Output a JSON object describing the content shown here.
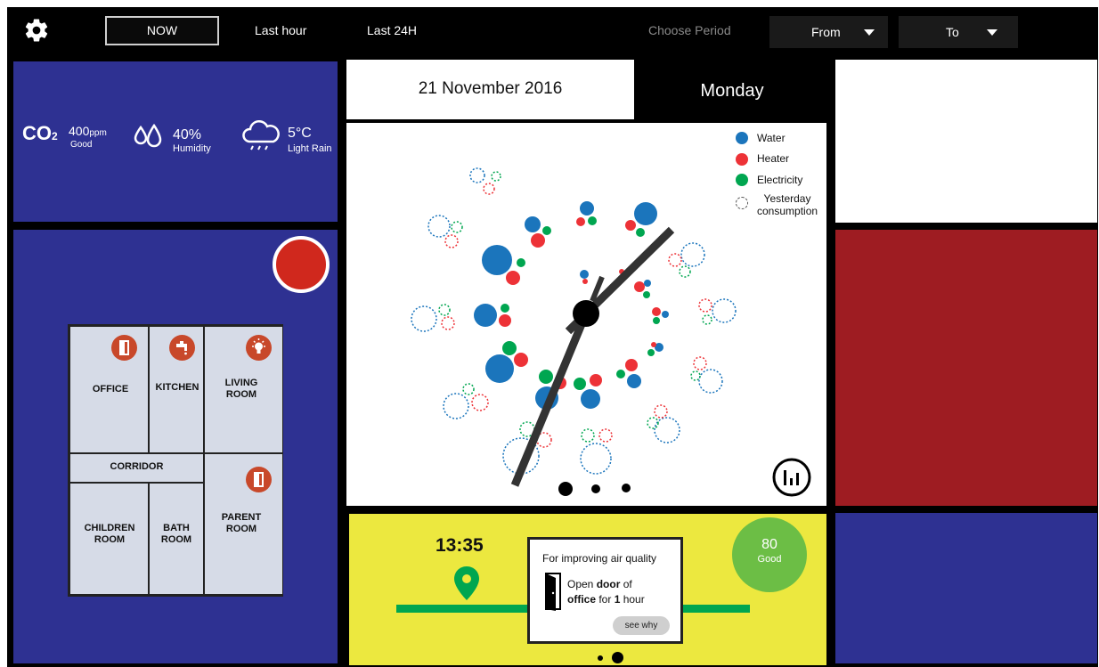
{
  "topbar": {
    "settings_icon": "gear-icon",
    "now_label": "NOW",
    "last_hour_label": "Last hour",
    "last_24h_label": "Last 24H",
    "choose_period_label": "Choose Period",
    "from_label": "From",
    "to_label": "To"
  },
  "environment": {
    "co2_label": "CO",
    "co2_sub": "2",
    "co2_value": "400",
    "co2_unit": "ppm",
    "co2_status": "Good",
    "humidity_value": "40%",
    "humidity_label": "Humidity",
    "temperature_value": "5°C",
    "weather_label": "Light Rain"
  },
  "floorplan": {
    "rooms": {
      "office": "OFFICE",
      "kitchen": "KITCHEN",
      "living_line1": "LIVING",
      "living_line2": "ROOM",
      "corridor": "CORRIDOR",
      "children_line1": "CHILDREN",
      "children_line2": "ROOM",
      "bath_line1": "BATH",
      "bath_line2": "ROOM",
      "parent_line1": "PARENT",
      "parent_line2": "ROOM"
    }
  },
  "date_header": {
    "date": "21 November 2016",
    "day": "Monday"
  },
  "legend": {
    "water": "Water",
    "heater": "Heater",
    "electricity": "Electricity",
    "yesterday_line1": "Yesterday",
    "yesterday_line2": "consumption",
    "colors": {
      "water": "#1b75bc",
      "heater": "#ed3237",
      "electricity": "#00a650"
    }
  },
  "air_card": {
    "time": "13:35",
    "tip_title": "For improving air quality",
    "tip_open": "Open ",
    "tip_door": "door",
    "tip_of": " of",
    "tip_office": "office",
    "tip_for": " for ",
    "tip_hours": "1",
    "tip_hour_word": " hour",
    "see_why": "see why",
    "score": "80",
    "score_label": "Good"
  },
  "colors": {
    "panel_blue": "#2e3192",
    "alert_red": "#9e1c22",
    "card_yellow": "#ece83f",
    "score_green": "#6cbe45",
    "indicator_red": "#d0281d"
  }
}
